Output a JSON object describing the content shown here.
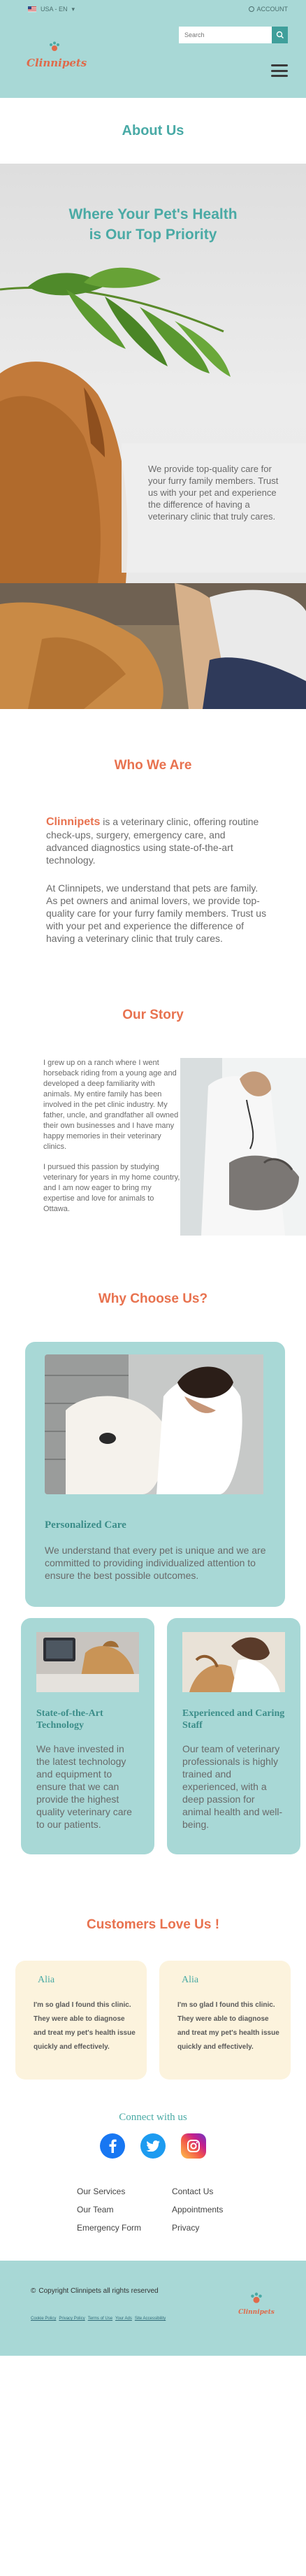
{
  "topbar": {
    "language": "USA - EN",
    "account": "ACCOUNT"
  },
  "search": {
    "placeholder": "Search"
  },
  "brand": {
    "name": "Clinnipets"
  },
  "page": {
    "title": "About Us"
  },
  "hero": {
    "headline_line1": "Where Your Pet's Health",
    "headline_line2": "is Our Top Priority",
    "card_text": "We provide top-quality care for your furry family members. Trust us with your pet and experience the difference of having a veterinary clinic that truly cares."
  },
  "who": {
    "title": "Who We Are",
    "brand_word": "Clinnipets",
    "p1_rest": " is a veterinary clinic, offering routine check-ups, surgery, emergency care, and advanced diagnostics using state-of-the-art technology.",
    "p2": "At Clinnipets, we understand that pets are family. As pet owners and animal lovers, we provide top-quality care for your furry family members. Trust us with your pet and experience the difference of having a veterinary clinic that truly cares."
  },
  "story": {
    "title": "Our Story",
    "p1": "I grew up on a ranch where I went horseback riding from a young age and developed a deep familiarity with animals. My entire family has been involved in the pet clinic industry. My father, uncle, and grandfather all owned their own businesses and I have many happy memories in their veterinary clinics.",
    "p2": "I pursued this passion by studying veterinary for years in my home country, and I am now eager to bring my expertise and love for animals to Ottawa."
  },
  "why": {
    "title": "Why Choose Us?",
    "cards": [
      {
        "title": "Personalized Care",
        "desc": "We understand that every pet is unique and we are committed to providing individualized attention to ensure the best possible outcomes."
      },
      {
        "title": "State-of-the-Art Technology",
        "desc": "We have invested in the latest technology and equipment to ensure that we can provide the highest quality veterinary care to our patients."
      },
      {
        "title": "Experienced and Caring Staff",
        "desc": "Our team of veterinary professionals is highly trained and experienced, with a deep passion for animal health and well-being."
      }
    ]
  },
  "reviews": {
    "title": "Customers Love Us !",
    "items": [
      {
        "author": "Alia",
        "quote": "I'm so glad I found this clinic. They were able to diagnose and treat my pet's health issue quickly and effectively."
      },
      {
        "author": "Alia",
        "quote": "I'm so glad I found this clinic. They were able to diagnose and treat my pet's health issue quickly and effectively."
      }
    ]
  },
  "footer": {
    "connect": "Connect with us",
    "links": [
      "Our Services",
      "Contact Us",
      "Our Team",
      "Appointments",
      "Emergency Form",
      "Privacy"
    ],
    "copyright": "Copyright Clinnipets all rights reserved",
    "legal": [
      "Cookie Policy",
      "Privacy Policy",
      "Terms of Use",
      "Your Ads",
      "Site Accessibility"
    ]
  },
  "colors": {
    "teal": "#a8d8d6",
    "teal_text": "#49aaa6",
    "coral": "#e8724f",
    "cream": "#fcf3dd"
  }
}
